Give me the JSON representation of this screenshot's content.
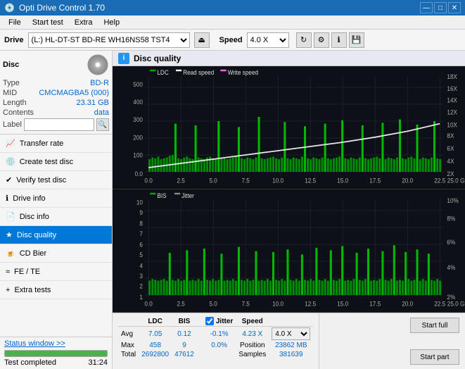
{
  "app": {
    "title": "Opti Drive Control 1.70",
    "icon": "●"
  },
  "titlebar": {
    "minimize": "—",
    "maximize": "□",
    "close": "✕"
  },
  "menu": {
    "items": [
      "File",
      "Start test",
      "Extra",
      "Help"
    ]
  },
  "drive_bar": {
    "label": "Drive",
    "drive_value": "(L:)  HL-DT-ST BD-RE  WH16NS58 TST4",
    "speed_label": "Speed",
    "speed_value": "4.0 X"
  },
  "disc_panel": {
    "title": "Disc",
    "type_label": "Type",
    "type_value": "BD-R",
    "mid_label": "MID",
    "mid_value": "CMCMAGBA5 (000)",
    "length_label": "Length",
    "length_value": "23.31 GB",
    "contents_label": "Contents",
    "contents_value": "data",
    "label_label": "Label",
    "label_value": ""
  },
  "nav_items": [
    {
      "id": "transfer-rate",
      "label": "Transfer rate",
      "icon": "📈"
    },
    {
      "id": "create-test-disc",
      "label": "Create test disc",
      "icon": "💿"
    },
    {
      "id": "verify-test-disc",
      "label": "Verify test disc",
      "icon": "✔"
    },
    {
      "id": "drive-info",
      "label": "Drive info",
      "icon": "ℹ"
    },
    {
      "id": "disc-info",
      "label": "Disc info",
      "icon": "📄"
    },
    {
      "id": "disc-quality",
      "label": "Disc quality",
      "icon": "★",
      "active": true
    },
    {
      "id": "cd-bier",
      "label": "CD Bier",
      "icon": "🍺"
    },
    {
      "id": "fe-te",
      "label": "FE / TE",
      "icon": "≈"
    },
    {
      "id": "extra-tests",
      "label": "Extra tests",
      "icon": "+"
    }
  ],
  "status_bar": {
    "window_btn": "Status window >>",
    "progress": 100,
    "status_text": "Test completed",
    "time_text": "31:24"
  },
  "disc_quality": {
    "title": "Disc quality",
    "legend": {
      "ldc": "LDC",
      "read_speed": "Read speed",
      "write_speed": "Write speed",
      "bis": "BIS",
      "jitter": "Jitter"
    },
    "chart1": {
      "y_labels": [
        "500",
        "400",
        "300",
        "200",
        "100",
        "0.0"
      ],
      "y_labels_right": [
        "18X",
        "16X",
        "14X",
        "12X",
        "10X",
        "8X",
        "6X",
        "4X",
        "2X"
      ],
      "x_labels": [
        "0.0",
        "2.5",
        "5.0",
        "7.5",
        "10.0",
        "12.5",
        "15.0",
        "17.5",
        "20.0",
        "22.5",
        "25.0 GB"
      ]
    },
    "chart2": {
      "y_labels": [
        "10",
        "9",
        "8",
        "7",
        "6",
        "5",
        "4",
        "3",
        "2",
        "1"
      ],
      "y_labels_right": [
        "10%",
        "8%",
        "6%",
        "4%",
        "2%"
      ],
      "x_labels": [
        "0.0",
        "2.5",
        "5.0",
        "7.5",
        "10.0",
        "12.5",
        "15.0",
        "17.5",
        "20.0",
        "22.5",
        "25.0 GB"
      ]
    }
  },
  "stats": {
    "headers": [
      "",
      "LDC",
      "BIS",
      "",
      "Jitter",
      "Speed",
      ""
    ],
    "rows": [
      {
        "label": "Avg",
        "ldc": "7.05",
        "bis": "0.12",
        "jitter": "-0.1%",
        "speed": "4.23 X",
        "speed2": "4.0 X"
      },
      {
        "label": "Max",
        "ldc": "458",
        "bis": "9",
        "jitter": "0.0%",
        "position_label": "Position",
        "position": "23862 MB"
      },
      {
        "label": "Total",
        "ldc": "2692800",
        "bis": "47612",
        "samples_label": "Samples",
        "samples": "381639"
      }
    ],
    "jitter_checked": true,
    "start_full": "Start full",
    "start_part": "Start part"
  }
}
